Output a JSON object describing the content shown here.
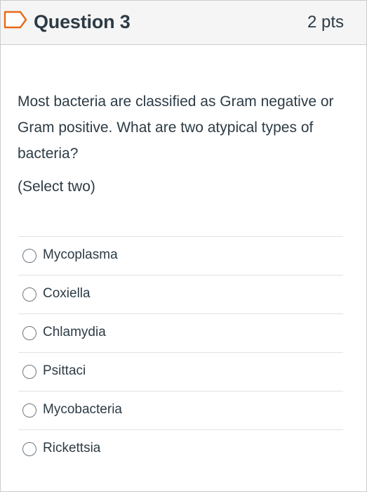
{
  "question": {
    "title": "Question 3",
    "points": "2 pts",
    "text": "Most bacteria are classified as Gram negative or Gram positive.  What are two atypical types of bacteria?",
    "instruction": "(Select two)"
  },
  "answers": [
    {
      "label": "Mycoplasma",
      "checked": false
    },
    {
      "label": "Coxiella",
      "checked": false
    },
    {
      "label": "Chlamydia",
      "checked": false
    },
    {
      "label": "Psittaci",
      "checked": false
    },
    {
      "label": "Mycobacteria",
      "checked": false
    },
    {
      "label": "Rickettsia",
      "checked": false
    }
  ],
  "icons": {
    "flag": "flag-icon",
    "option": "radio-icon"
  },
  "colors": {
    "header_background": "#f5f5f5",
    "text": "#2d3b45",
    "border": "#c7cdd1",
    "flag_outline": "#e66a16"
  }
}
